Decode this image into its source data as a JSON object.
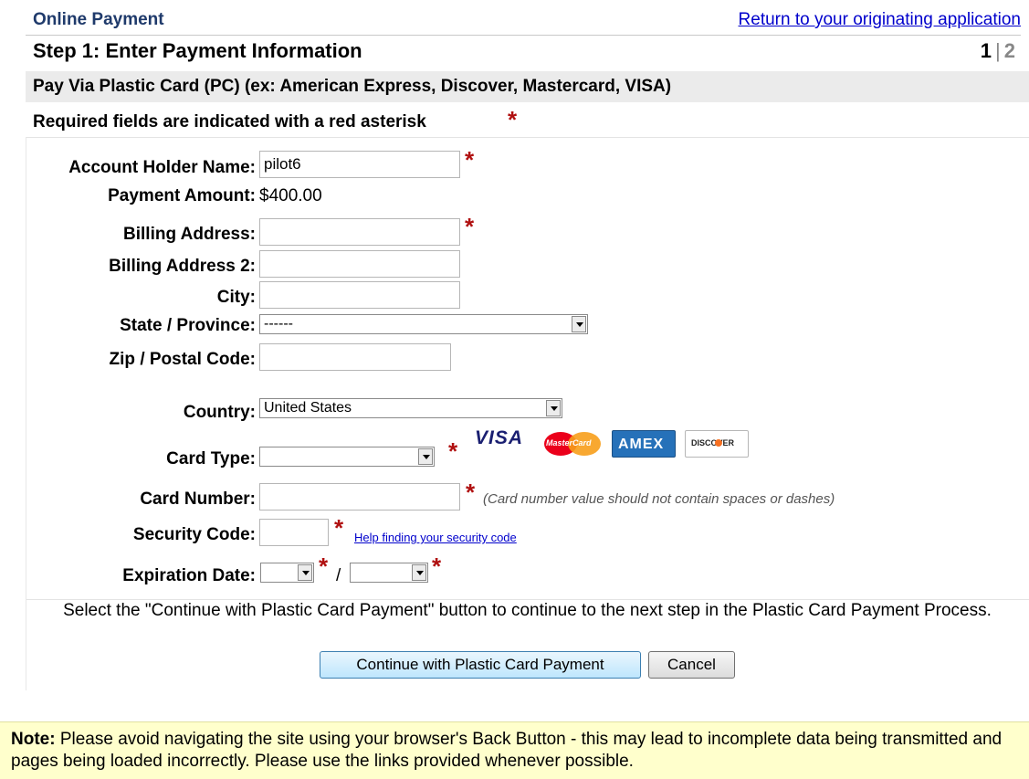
{
  "header": {
    "app_title": "Online Payment",
    "return_link": "Return to your originating application"
  },
  "step": {
    "title": "Step 1: Enter Payment Information",
    "current": "1",
    "separator": "|",
    "next": "2"
  },
  "payment_method": {
    "title": "Pay Via Plastic Card (PC) (ex: American Express, Discover, Mastercard, VISA)"
  },
  "required_note": "Required fields are indicated with a red asterisk",
  "asterisk": "*",
  "form": {
    "account_holder": {
      "label": "Account Holder Name:",
      "value": "pilot6"
    },
    "payment_amount": {
      "label": "Payment Amount:",
      "value": "$400.00"
    },
    "billing_address": {
      "label": "Billing Address:",
      "value": ""
    },
    "billing_address_2": {
      "label": "Billing Address 2:",
      "value": ""
    },
    "city": {
      "label": "City:",
      "value": ""
    },
    "state": {
      "label": "State / Province:",
      "value": "------"
    },
    "zip": {
      "label": "Zip / Postal Code:",
      "value": ""
    },
    "country": {
      "label": "Country:",
      "value": "United States"
    },
    "card_type": {
      "label": "Card Type:",
      "value": ""
    },
    "card_number": {
      "label": "Card Number:",
      "value": "",
      "hint": "(Card number value should not contain spaces or dashes)"
    },
    "security_code": {
      "label": "Security Code:",
      "value": "",
      "help_link": "Help finding your security code"
    },
    "expiration": {
      "label": "Expiration Date:",
      "month": "",
      "year": "",
      "separator": "/"
    }
  },
  "card_logos": {
    "visa": "VISA",
    "mastercard": "MasterCard",
    "amex": "AMEX",
    "discover": "DISCOVER"
  },
  "instruction": "Select the \"Continue with Plastic Card Payment\" button to continue to the next step in the Plastic Card Payment Process.",
  "buttons": {
    "continue": "Continue with Plastic Card Payment",
    "cancel": "Cancel"
  },
  "note": {
    "label": "Note:",
    "text": " Please avoid navigating the site using your browser's Back Button - this may lead to incomplete data being transmitted and pages being loaded incorrectly. Please use the links provided whenever possible."
  },
  "colors": {
    "asterisk": "#b01010",
    "link": "#0000cc",
    "title": "#1f3a6b",
    "note_bg": "#ffffcc"
  }
}
